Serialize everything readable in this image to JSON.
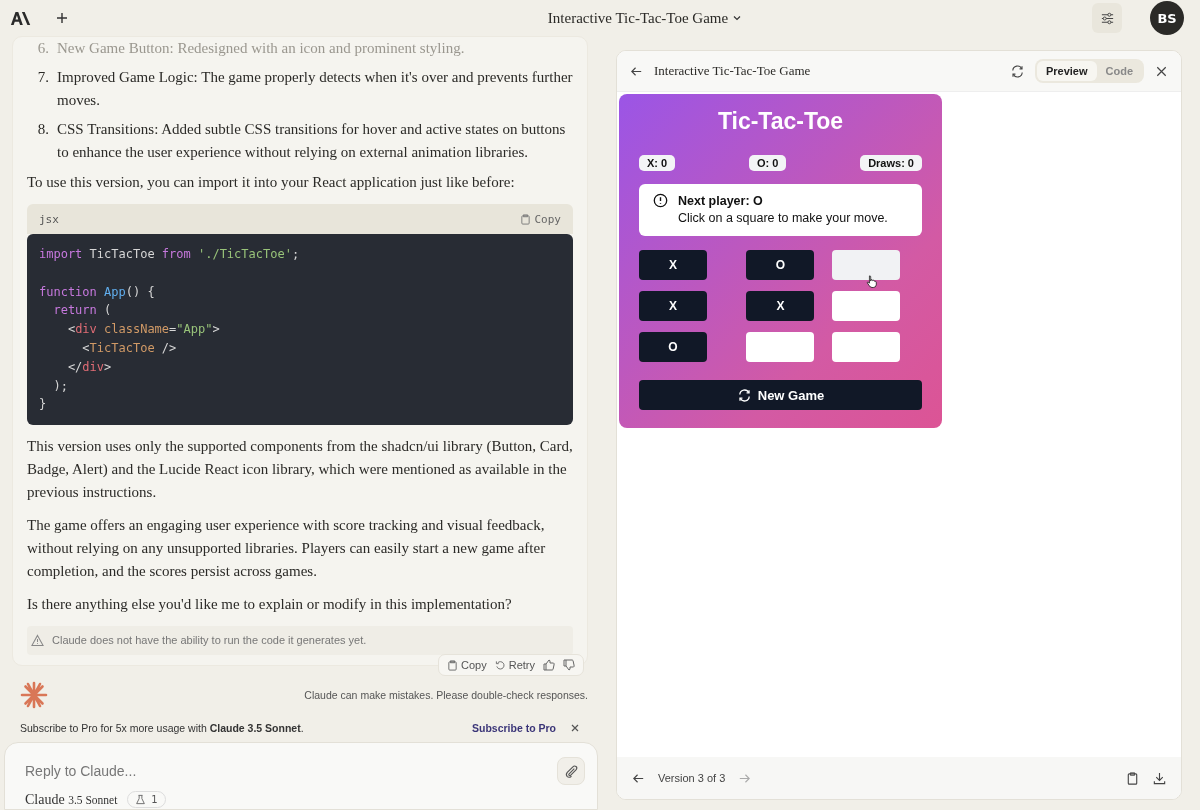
{
  "header": {
    "title": "Interactive Tic-Tac-Toe Game",
    "avatar": "BS"
  },
  "message": {
    "list": [
      {
        "number": "6.",
        "text": "New Game Button: Redesigned with an icon and prominent styling.",
        "faded": true
      },
      {
        "number": "7.",
        "text": "Improved Game Logic: The game properly detects when it's over and prevents further moves.",
        "faded": false
      },
      {
        "number": "8.",
        "text": "CSS Transitions: Added subtle CSS transitions for hover and active states on buttons to enhance the user experience without relying on external animation libraries.",
        "faded": false
      }
    ],
    "intro": "To use this version, you can import it into your React application just like before:",
    "code": {
      "language": "jsx",
      "copy": "Copy",
      "lines": [
        {
          "spaced": false,
          "tokens": [
            {
              "kind": "keyword",
              "text": "import"
            },
            {
              "kind": "plain",
              "text": " TicTacToe "
            },
            {
              "kind": "keyword",
              "text": "from"
            },
            {
              "kind": "string",
              "text": " './TicTacToe'"
            },
            {
              "kind": "plain",
              "text": ";"
            }
          ]
        },
        {
          "spaced": true,
          "tokens": [
            {
              "kind": "keyword",
              "text": "function"
            },
            {
              "kind": "name",
              "text": " App"
            },
            {
              "kind": "plain",
              "text": "() {"
            }
          ]
        },
        {
          "spaced": false,
          "tokens": [
            {
              "kind": "keyword",
              "text": "  return"
            },
            {
              "kind": "plain",
              "text": " ("
            }
          ]
        },
        {
          "spaced": false,
          "tokens": [
            {
              "kind": "plain",
              "text": "    <"
            },
            {
              "kind": "tag",
              "text": "div"
            },
            {
              "kind": "attr",
              "text": " className"
            },
            {
              "kind": "plain",
              "text": "="
            },
            {
              "kind": "string",
              "text": "\"App\""
            },
            {
              "kind": "plain",
              "text": ">"
            }
          ]
        },
        {
          "spaced": false,
          "tokens": [
            {
              "kind": "plain",
              "text": "      <"
            },
            {
              "kind": "attr",
              "text": "TicTacToe"
            },
            {
              "kind": "plain",
              "text": " />"
            }
          ]
        },
        {
          "spaced": false,
          "tokens": [
            {
              "kind": "plain",
              "text": "    </"
            },
            {
              "kind": "tag",
              "text": "div"
            },
            {
              "kind": "plain",
              "text": ">"
            }
          ]
        },
        {
          "spaced": false,
          "tokens": [
            {
              "kind": "plain",
              "text": "  );"
            }
          ]
        },
        {
          "spaced": false,
          "tokens": [
            {
              "kind": "plain",
              "text": "}"
            }
          ]
        }
      ]
    },
    "paragraphs": [
      "This version uses only the supported components from the shadcn/ui library (Button, Card, Badge, Alert) and the Lucide React icon library, which were mentioned as available in the previous instructions.",
      "The game offers an engaging user experience with score tracking and visual feedback, without relying on any unsupported libraries. Players can easily start a new game after completion, and the scores persist across games.",
      "Is there anything else you'd like me to explain or modify in this implementation?"
    ],
    "warning": "Claude does not have the ability to run the code it generates yet.",
    "actions": [
      "Copy",
      "Retry"
    ]
  },
  "disclaimer": "Claude can make mistakes. Please double-check responses.",
  "promo": {
    "text": "Subscribe to Pro for 5x more usage with **Claude 3.5 Sonnet**.",
    "link": "Subscribe to Pro"
  },
  "composer": {
    "placeholder": "Reply to Claude...",
    "model_name": "Claude",
    "model_version": "3.5 Sonnet",
    "badge": "1"
  },
  "artifact": {
    "title": "Interactive Tic-Tac-Toe Game",
    "tabs": [
      {
        "label": "Preview",
        "selected": true
      },
      {
        "label": "Code",
        "selected": false
      }
    ],
    "game": {
      "title": "Tic-Tac-Toe",
      "scores": [
        "X: 0",
        "O: 0",
        "Draws: 0"
      ],
      "alert": {
        "title": "Next player: O",
        "text": "Click on a square to make your move."
      },
      "cells": [
        {
          "value": "X",
          "hovered": false
        },
        {
          "value": "O",
          "hovered": false
        },
        {
          "hovered": true
        },
        {
          "value": "X",
          "hovered": false
        },
        {
          "value": "X",
          "hovered": false
        },
        {
          "hovered": false
        },
        {
          "value": "O",
          "hovered": false
        },
        {
          "hovered": false
        },
        {
          "hovered": false
        }
      ],
      "new_game": "New Game"
    },
    "version": "Version 3 of 3"
  }
}
